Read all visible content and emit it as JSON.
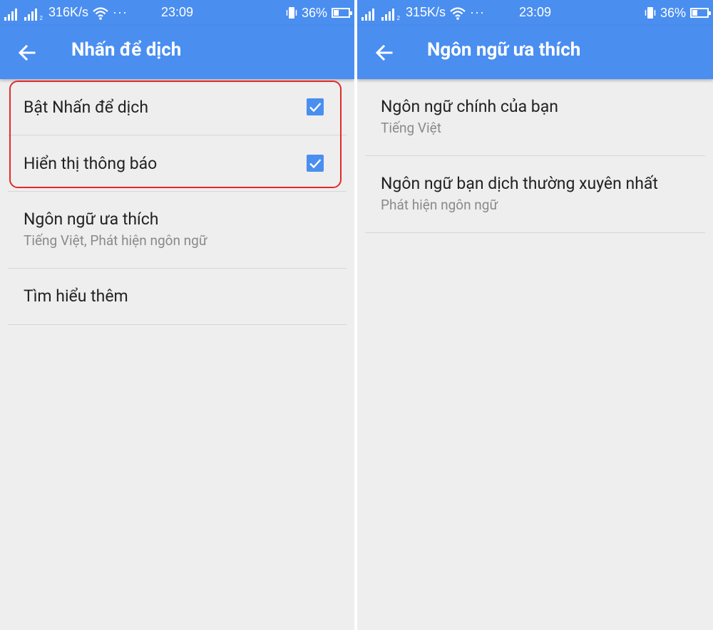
{
  "colors": {
    "primary": "#4a8ef0",
    "background": "#eeeeee",
    "highlight": "#e32a2a"
  },
  "left": {
    "statusbar": {
      "speed": "316K/s",
      "dots": "···",
      "time": "23:09",
      "battery": "36%",
      "battery_level": 0.36
    },
    "title": "Nhấn để dịch",
    "back_icon": "arrow-back-icon",
    "toggles": [
      {
        "label": "Bật Nhấn để dịch",
        "checked": true
      },
      {
        "label": "Hiển thị thông báo",
        "checked": true
      }
    ],
    "preferred": {
      "title": "Ngôn ngữ ưa thích",
      "subtitle": "Tiếng Việt, Phát hiện ngôn ngữ"
    },
    "learn_more": "Tìm hiểu thêm"
  },
  "right": {
    "statusbar": {
      "speed": "315K/s",
      "dots": "···",
      "time": "23:09",
      "battery": "36%",
      "battery_level": 0.36
    },
    "title": "Ngôn ngữ ưa thích",
    "back_icon": "arrow-back-icon",
    "items": [
      {
        "title": "Ngôn ngữ chính của bạn",
        "subtitle": "Tiếng Việt"
      },
      {
        "title": "Ngôn ngữ bạn dịch thường xuyên nhất",
        "subtitle": "Phát hiện ngôn ngữ"
      }
    ]
  }
}
